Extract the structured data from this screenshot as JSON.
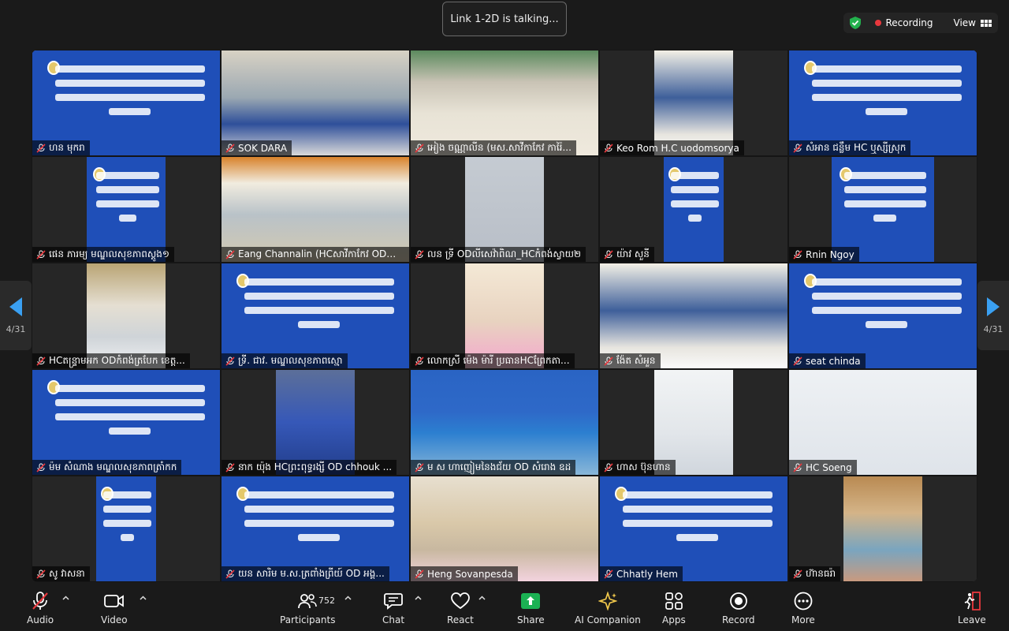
{
  "talking_indicator": "Link 1-2D is talking...",
  "recording": {
    "label": "Recording",
    "color": "#e8383d"
  },
  "view": {
    "label": "View"
  },
  "pagination": {
    "left": "4/31",
    "right": "4/31"
  },
  "tiles": [
    {
      "name": "ហន មុករា",
      "kind": "slide-person"
    },
    {
      "name": "SOK DARA",
      "kind": "photo-room"
    },
    {
      "name": "អៀង ចណ្ណាលីន (មស.សាវីកាកែវ ការ៉ៃ...",
      "kind": "photo-office"
    },
    {
      "name": "Keo Rom  H.C uodomsorya",
      "kind": "photo-window"
    },
    {
      "name": "សំអាន ជន្លឹម HC ឬស្សីស្រុក",
      "kind": "slide"
    },
    {
      "name": "ផេន ភារម្យ មណ្ឌលសុខភាពស្តូង១",
      "kind": "slide-person"
    },
    {
      "name": "Eang Channalin (HCសាវីកាកែវ ODឈូ...",
      "kind": "photo-sign"
    },
    {
      "name": "លន ទ្រី ODលីសេវ៉ាពិណ_HCកំពង់ស្វាយ២",
      "kind": "photo-blur"
    },
    {
      "name": "យ៉ាវ សួនី",
      "kind": "slide"
    },
    {
      "name": "Rnin Ngoy",
      "kind": "slide"
    },
    {
      "name": "HCតន្ទ្រាមអក ODកំពង់ត្របែក ខេត្ត...",
      "kind": "photo-wall"
    },
    {
      "name": "ទ្រី. ជាវ. មណ្ឌលសុខភាពស្មោ",
      "kind": "slide"
    },
    {
      "name": "លោកស្រី ម៉េង ម៉ារី ប្រធានHCព្រែកតា...",
      "kind": "photo-pink"
    },
    {
      "name": "ង៉ែត សំអួន",
      "kind": "photo-window"
    },
    {
      "name": "seat chinda",
      "kind": "slide"
    },
    {
      "name": "ម៉ម សំណាង មណ្ឌលសុខភាពត្រាំកក",
      "kind": "slide"
    },
    {
      "name": "នាក យ៉ុង HCព្រះពុទ្ធរង្សី OD chhouk ...",
      "kind": "photo-dark"
    },
    {
      "name": "ម ស ហាញៀមនៃងជ័យ  OD សំរោង ឧដ",
      "kind": "photo-mixed"
    },
    {
      "name": "ហាស ប៊ុនហាន",
      "kind": "photo-door"
    },
    {
      "name": "HC Soeng",
      "kind": "photo-paper"
    },
    {
      "name": "សូ វាសនា",
      "kind": "slide"
    },
    {
      "name": "យន សារិម ម.ស.ត្រពាំងព្រីយ៍ OD អង្គ...",
      "kind": "slide-person"
    },
    {
      "name": "Heng Sovanpesda",
      "kind": "photo-frames"
    },
    {
      "name": "Chhatly Hem",
      "kind": "slide-person"
    },
    {
      "name": "ហ៊ានធរ៉ា",
      "kind": "photo-roof"
    }
  ],
  "toolbar": {
    "audio": "Audio",
    "video": "Video",
    "participants": "Participants",
    "participants_count": "752",
    "chat": "Chat",
    "react": "React",
    "share": "Share",
    "ai_companion": "AI Companion",
    "apps": "Apps",
    "record": "Record",
    "more": "More",
    "leave": "Leave"
  }
}
